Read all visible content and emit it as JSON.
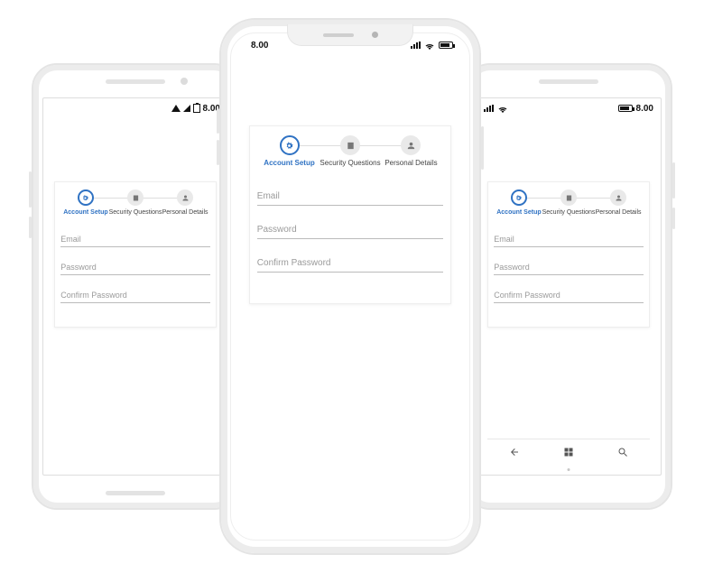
{
  "status": {
    "time_left": "8.00",
    "time_center": "8.00",
    "time_right": "8.00"
  },
  "wizard": {
    "steps": [
      {
        "label": "Account Setup",
        "icon": "gear-icon",
        "active": true
      },
      {
        "label": "Security Questions",
        "icon": "list-icon",
        "active": false
      },
      {
        "label": "Personal Details",
        "icon": "person-icon",
        "active": false
      }
    ],
    "fields": {
      "email_placeholder": "Email",
      "password_placeholder": "Password",
      "confirm_placeholder": "Confirm Password"
    }
  },
  "colors": {
    "accent": "#2f72c3"
  }
}
